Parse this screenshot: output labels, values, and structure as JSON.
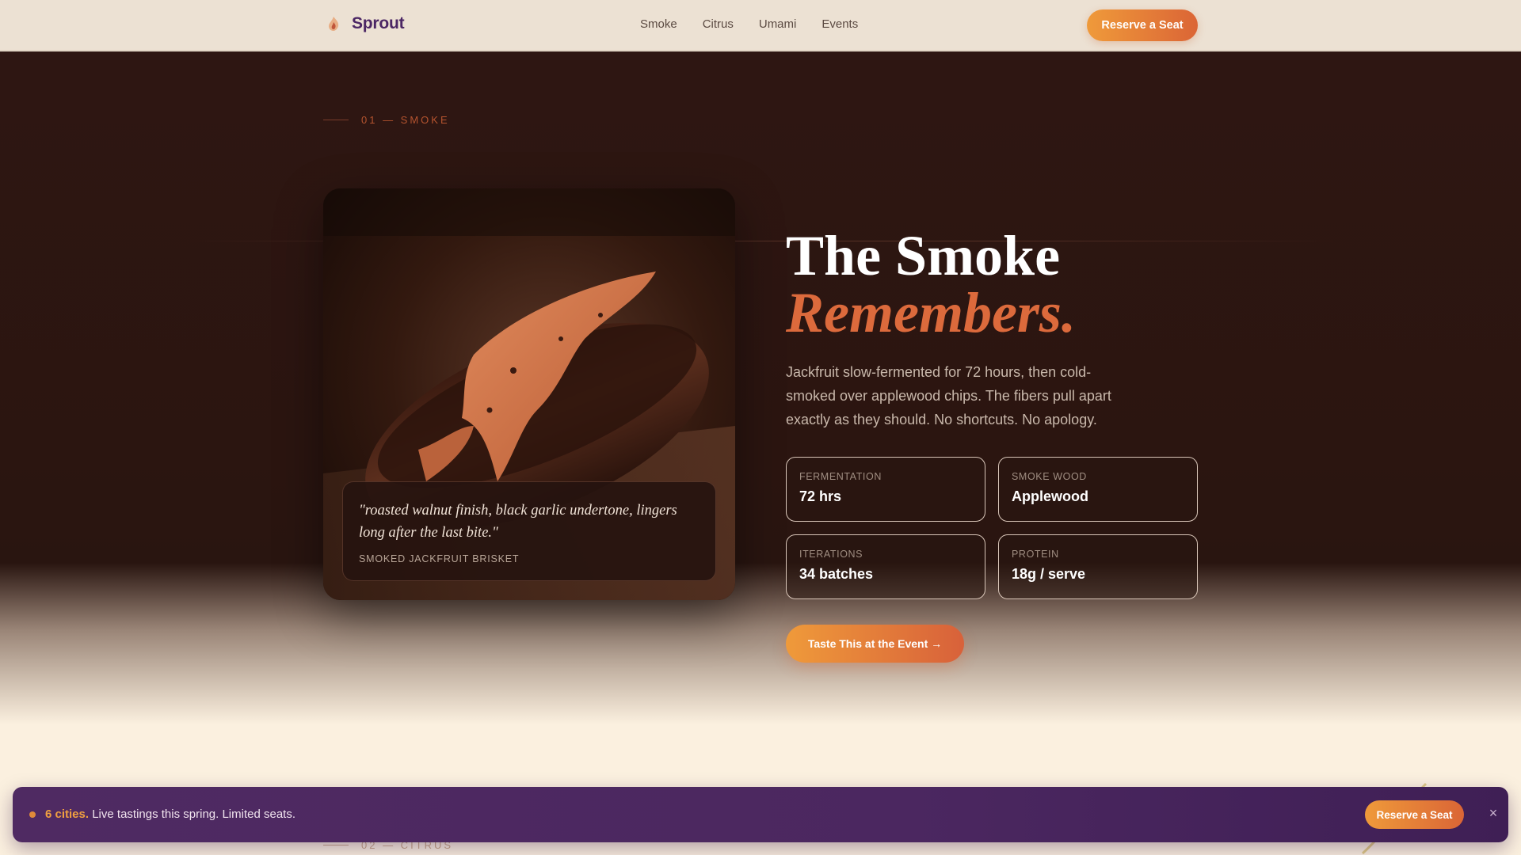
{
  "nav": {
    "brand": "Sprout",
    "logo_icon": "flame-leaf-icon",
    "links": [
      "Smoke",
      "Citrus",
      "Umami",
      "Events"
    ],
    "cta_label": "Reserve a Seat"
  },
  "hero": {
    "section_label": "01 — SMOKE",
    "headline_line1": "The Smoke",
    "headline_line2": "Remembers.",
    "description": "Jackfruit slow-fermented for 72 hours, then cold-smoked over applewood chips. The fibers pull apart exactly as they should. No shortcuts. No apology.",
    "quote": "\"roasted walnut finish, black garlic undertone, lingers long after the last bite.\"",
    "quote_caption": "SMOKED JACKFRUIT BRISKET",
    "stats": [
      {
        "label": "FERMENTATION",
        "value": "72 hrs"
      },
      {
        "label": "SMOKE WOOD",
        "value": "Applewood"
      },
      {
        "label": "ITERATIONS",
        "value": "34 batches"
      },
      {
        "label": "PROTEIN",
        "value": "18g / serve"
      }
    ],
    "cta_label": "Taste This at the Event →"
  },
  "next_section": {
    "label": "02 — CITRUS"
  },
  "banner": {
    "highlight": "6 cities.",
    "text": " Live tastings this spring. Limited seats.",
    "cta_label": "Reserve a Seat",
    "close_symbol": "×"
  },
  "colors": {
    "brand": "#4b2664",
    "accent": "#dc6a3c",
    "cta_gradient_start": "#ef9a3a",
    "cta_gradient_end": "#db6536",
    "hero_bg": "#2b1510",
    "banner_bg": "#4b2760"
  }
}
